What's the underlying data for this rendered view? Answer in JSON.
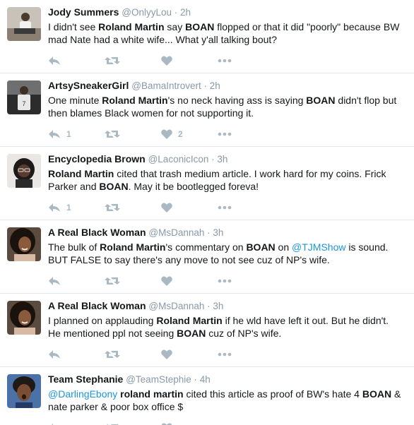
{
  "tweets": [
    {
      "name": "Jody Summers",
      "handle": "@OnlyyLou",
      "time": "2h",
      "body": [
        {
          "t": "I didn't see "
        },
        {
          "t": "Roland Martin",
          "b": true
        },
        {
          "t": " say "
        },
        {
          "t": "BOAN",
          "b": true
        },
        {
          "t": " flopped or that it did \"poorly\" because BW mad Nate had a white wife... What y'all talking bout?"
        }
      ],
      "reply_count": "",
      "retweet_count": "",
      "like_count": "",
      "avatar": "avatar-photo-seated-man"
    },
    {
      "name": "ArtsySneakerGirl",
      "handle": "@BamaIntrovert",
      "time": "2h",
      "body": [
        {
          "t": "One minute "
        },
        {
          "t": "Roland Martin",
          "b": true
        },
        {
          "t": "'s no neck having ass is saying "
        },
        {
          "t": "BOAN",
          "b": true
        },
        {
          "t": " didn't flop but then blames Black women for not supporting it."
        }
      ],
      "reply_count": "1",
      "retweet_count": "",
      "like_count": "2",
      "avatar": "avatar-photo-basketball-player"
    },
    {
      "name": "Encyclopedia Brown",
      "handle": "@LaconicIcon",
      "time": "3h",
      "body": [
        {
          "t": "Roland Martin",
          "b": true
        },
        {
          "t": " cited that trash medium article. I work hard for my coins. Frick Parker and "
        },
        {
          "t": "BOAN",
          "b": true
        },
        {
          "t": ". May it be bootlegged foreva!"
        }
      ],
      "reply_count": "1",
      "retweet_count": "",
      "like_count": "",
      "avatar": "avatar-photo-woman-glasses"
    },
    {
      "name": "A Real Black Woman",
      "handle": "@MsDannah",
      "time": "3h",
      "body": [
        {
          "t": "The bulk of "
        },
        {
          "t": "Roland Martin",
          "b": true
        },
        {
          "t": "'s commentary on "
        },
        {
          "t": "BOAN",
          "b": true
        },
        {
          "t": " on "
        },
        {
          "t": "@TJMShow",
          "m": true
        },
        {
          "t": " is sound. BUT FALSE to say there's any move to not see cuz of NP's wife."
        }
      ],
      "reply_count": "",
      "retweet_count": "",
      "like_count": "",
      "avatar": "avatar-photo-woman-curly-hair"
    },
    {
      "name": "A Real Black Woman",
      "handle": "@MsDannah",
      "time": "3h",
      "body": [
        {
          "t": "I planned on applauding "
        },
        {
          "t": "Roland Martin",
          "b": true
        },
        {
          "t": " if he wld have left it out. But he didn't. He mentioned ppl not seeing "
        },
        {
          "t": "BOAN",
          "b": true
        },
        {
          "t": " cuz of NP's wife."
        }
      ],
      "reply_count": "",
      "retweet_count": "",
      "like_count": "",
      "avatar": "avatar-photo-woman-curly-hair"
    },
    {
      "name": "Team Stephanie",
      "handle": "@TeamStephie",
      "time": "4h",
      "body": [
        {
          "t": "@DarlingEbony",
          "m": true
        },
        {
          "t": " "
        },
        {
          "t": "roland martin",
          "b": true
        },
        {
          "t": " cited this article as proof of BW's hate 4 "
        },
        {
          "t": "BOAN",
          "b": true
        },
        {
          "t": " & nate parker & poor box office $"
        }
      ],
      "reply_count": "",
      "retweet_count": "",
      "like_count": "",
      "avatar": "avatar-photo-woman-surprised"
    }
  ],
  "icons": {
    "reply": "reply-icon",
    "retweet": "retweet-icon",
    "like": "heart-icon",
    "more": "more-dots-icon"
  },
  "colors": {
    "name": "#14171a",
    "meta": "#8899a6",
    "mention": "#1b95e0",
    "action": "#aab8c2",
    "divider": "#e1e8ed"
  }
}
